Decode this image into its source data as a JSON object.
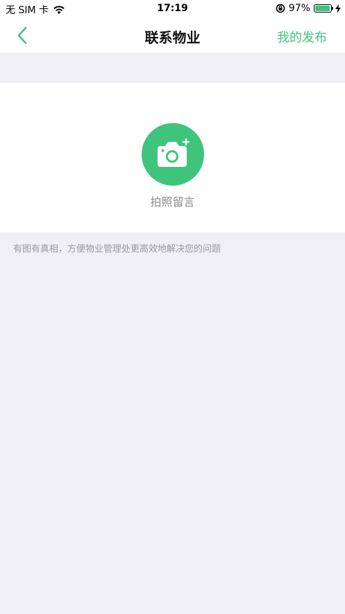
{
  "status_bar": {
    "carrier": "无 SIM 卡",
    "time": "17:19",
    "battery_percent": "97%",
    "battery_level": 0.97
  },
  "nav": {
    "title": "联系物业",
    "right_action": "我的发布",
    "accent_color": "#3fc47c"
  },
  "upload": {
    "label": "拍照留言",
    "icon": "camera-plus-icon"
  },
  "hint": "有图有真相，方便物业管理处更高效地解决您的问题"
}
